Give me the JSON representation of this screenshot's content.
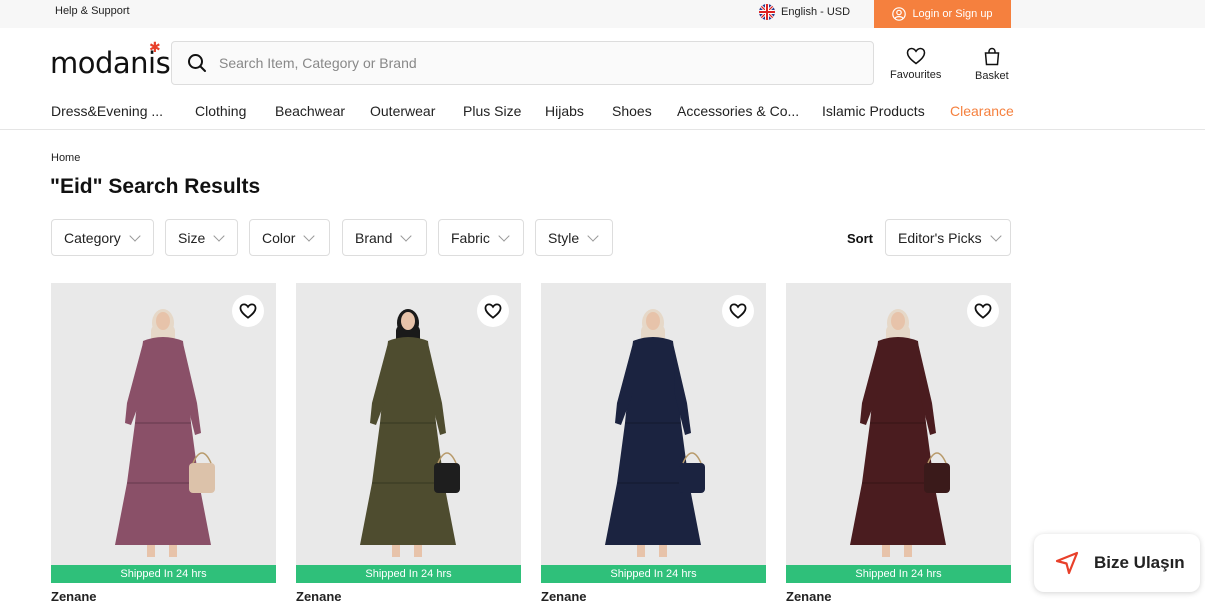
{
  "topbar": {
    "help": "Help & Support",
    "language": "English - USD",
    "login": "Login or Sign up"
  },
  "header": {
    "logo": "modanisa",
    "search_placeholder": "Search Item, Category or Brand",
    "favourites": "Favourites",
    "basket": "Basket"
  },
  "nav": [
    "Dress&Evening ...",
    "Clothing",
    "Beachwear",
    "Outerwear",
    "Plus Size",
    "Hijabs",
    "Shoes",
    "Accessories & Co...",
    "Islamic Products",
    "Clearance"
  ],
  "breadcrumb": "Home",
  "page_title": "\"Eid\" Search Results",
  "filters": [
    "Category",
    "Size",
    "Color",
    "Brand",
    "Fabric",
    "Style"
  ],
  "sort": {
    "label": "Sort",
    "value": "Editor's Picks"
  },
  "products": [
    {
      "badge": "Shipped In 24 hrs",
      "brand": "Zenane",
      "dress_color": "#8a5068",
      "bag_color": "#dcc2aa",
      "hijab_color": "#e6d8c8",
      "bg_color": "#e9e9e9"
    },
    {
      "badge": "Shipped In 24 hrs",
      "brand": "Zenane",
      "dress_color": "#4e4c2f",
      "bag_color": "#1e1e1e",
      "hijab_color": "#1a1a1a",
      "bg_color": "#e9e9e9"
    },
    {
      "badge": "Shipped In 24 hrs",
      "brand": "Zenane",
      "dress_color": "#1b2340",
      "bag_color": "#1b2340",
      "hijab_color": "#e6d8c8",
      "bg_color": "#e9e9e9"
    },
    {
      "badge": "Shipped In 24 hrs",
      "brand": "Zenane",
      "dress_color": "#4a1c1f",
      "bag_color": "#3a1a1a",
      "hijab_color": "#e6d8c8",
      "bg_color": "#e9e9e9"
    }
  ],
  "chat": {
    "label": "Bize Ulaşın"
  },
  "colors": {
    "accent": "#f5803e",
    "shipped": "#2fc07a",
    "logo_dot": "#e8402a"
  }
}
